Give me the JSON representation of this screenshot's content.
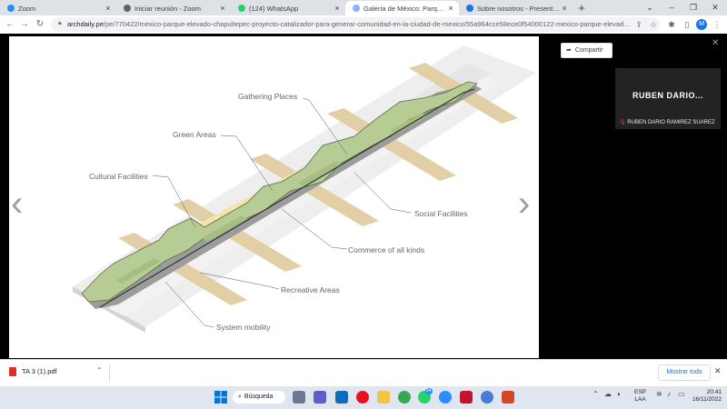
{
  "browser": {
    "tabs": [
      {
        "title": "Zoom",
        "active": false,
        "icon": "zoom-icon",
        "icon_color": "#2d8cff"
      },
      {
        "title": "Iniciar reunión - Zoom",
        "active": false,
        "icon": "globe-icon",
        "icon_color": "#5f6368"
      },
      {
        "title": "(124) WhatsApp",
        "active": false,
        "icon": "whatsapp-icon",
        "icon_color": "#25d366"
      },
      {
        "title": "Galería de México: Parque Elevado",
        "active": true,
        "icon": "archdaily-icon",
        "icon_color": "#8ab4f8"
      },
      {
        "title": "Sobre nosotros - Presentación",
        "active": false,
        "icon": "google-slides-icon",
        "icon_color": "#1a73e8"
      }
    ],
    "url_domain": "archdaily.pe",
    "url_path": "/pe/770422/mexico-parque-elevado-chapultepec-proyecto-catalizador-para-generar-comunidad-en-la-ciudad-de-mexico/55a964cce58ece0f54000122-mexico-parque-elevado-c...",
    "profile_initial": "M"
  },
  "page": {
    "share_label": "Compartir",
    "diagram_labels": {
      "gathering": "Gathering Places",
      "green": "Green Areas",
      "cultural": "Cultural Facilities",
      "social": "Social Facilities",
      "commerce": "Commerce of all kinds",
      "recreative": "Recreative Areas",
      "mobility": "System mobility"
    }
  },
  "zoom": {
    "display_name": "RUBEN  DARIO...",
    "participant_full_name": "RUBEN DARIO RAMIREZ SUAREZ"
  },
  "downloads": {
    "file_name": "TA 3 (1).pdf",
    "show_all_label": "Mostrar todo"
  },
  "taskbar": {
    "search_label": "Búsqueda",
    "lang_top": "ESP",
    "lang_bottom": "LAA",
    "time": "20:41",
    "date": "16/11/2022",
    "chat_badge": "54"
  },
  "colors": {
    "park_green": "#b7cc95",
    "road_beige": "#e2cfa6",
    "commerce_yellow": "#f2e6a8"
  }
}
